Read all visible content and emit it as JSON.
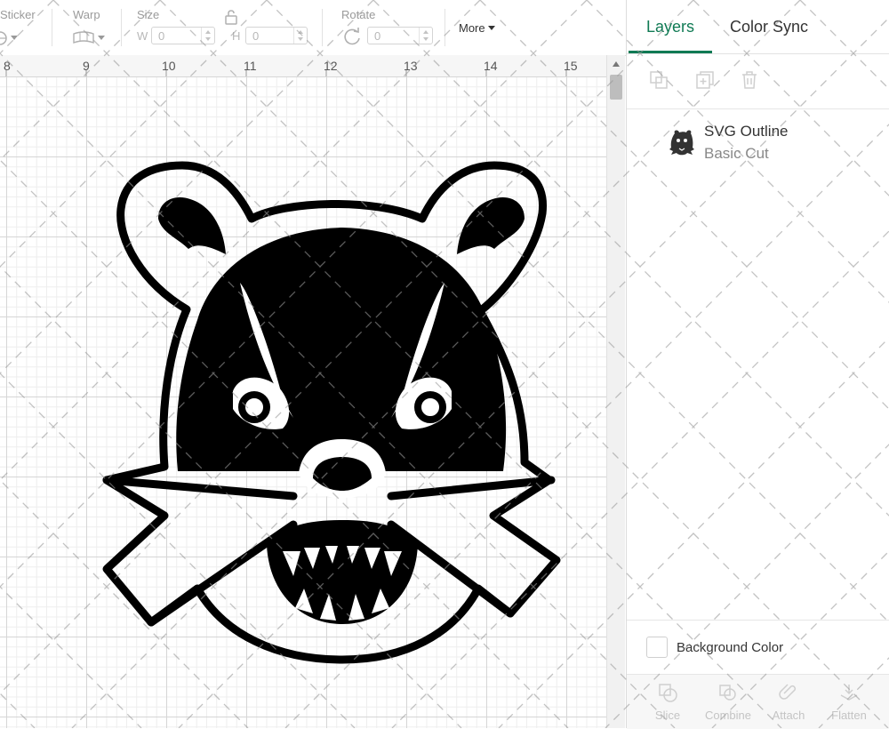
{
  "toolbar": {
    "sticker_label": "Sticker",
    "warp_label": "Warp",
    "size_label": "Size",
    "width_prefix": "W",
    "width_value": "0",
    "height_prefix": "H",
    "height_value": "0",
    "rotate_label": "Rotate",
    "rotate_value": "0",
    "more_label": "More"
  },
  "ruler": {
    "ticks": [
      "8",
      "9",
      "10",
      "11",
      "12",
      "13",
      "14",
      "15"
    ]
  },
  "panel": {
    "tabs": [
      {
        "label": "Layers",
        "active": true
      },
      {
        "label": "Color Sync",
        "active": false
      }
    ],
    "layer": {
      "name": "SVG Outline",
      "operation": "Basic Cut"
    },
    "background_color_label": "Background Color",
    "bottom_tools": [
      {
        "label": "Slice",
        "icon": "slice-icon"
      },
      {
        "label": "Combine",
        "icon": "combine-icon"
      },
      {
        "label": "Attach",
        "icon": "attach-icon"
      },
      {
        "label": "Flatten",
        "icon": "flatten-icon"
      }
    ]
  },
  "colors": {
    "accent": "#107a54",
    "design_fill": "#000000",
    "grid_major": "#d6d6d6",
    "grid_minor": "#eeeeee"
  }
}
